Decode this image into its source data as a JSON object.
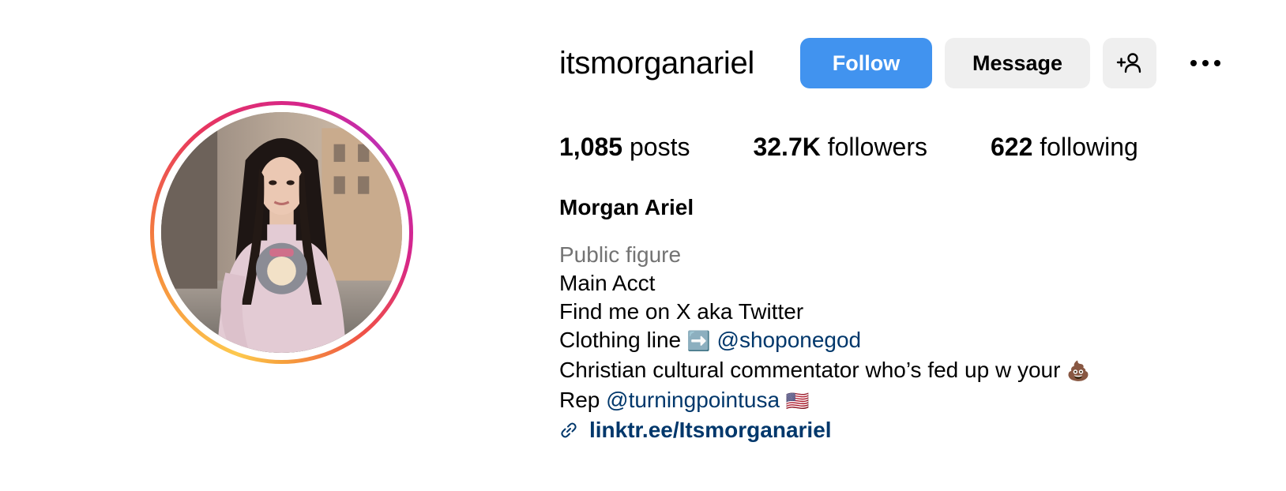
{
  "profile": {
    "username": "itsmorganariel",
    "display_name": "Morgan Ariel",
    "avatar": "profile-photo"
  },
  "actions": {
    "follow_label": "Follow",
    "message_label": "Message",
    "add_user_icon": "add-person-icon",
    "more_icon": "more-options-icon"
  },
  "stats": {
    "posts_count": "1,085",
    "posts_label": " posts",
    "followers_count": "32.7K",
    "followers_label": " followers",
    "following_count": "622",
    "following_label": " following"
  },
  "bio": {
    "category": "Public figure",
    "line1": "Main Acct",
    "line2": "Find me on X aka Twitter",
    "line3_prefix": "Clothing line ",
    "line3_emoji": "➡️",
    "line3_mention": "@shoponegod",
    "line4_text": "Christian cultural commentator who’s fed up w your ",
    "line4_emoji": "💩",
    "line5_prefix": "Rep ",
    "line5_mention": "@turningpointusa",
    "line5_emoji": "🇺🇸",
    "link_text": "linktr.ee/Itsmorganariel",
    "link_icon": "link-icon"
  },
  "colors": {
    "follow_button": "#4193ef",
    "secondary_button": "#efefef",
    "mention": "#00376b",
    "category_text": "#737373"
  }
}
